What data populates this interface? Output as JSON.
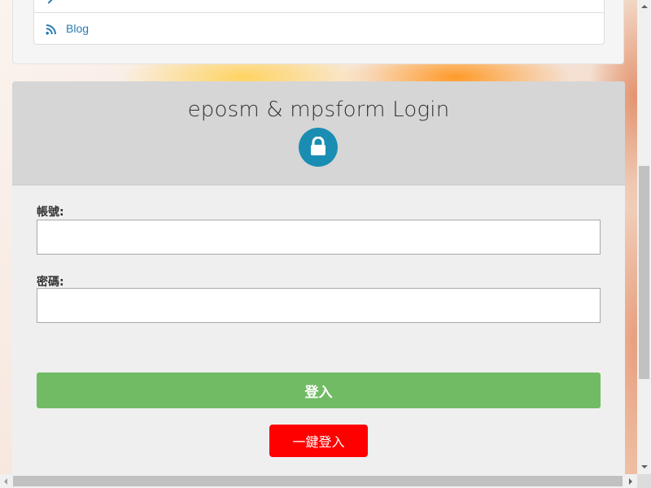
{
  "links": {
    "items": [
      {
        "label": "Blog",
        "icon": "rss-icon"
      }
    ]
  },
  "login": {
    "title": "eposm & mpsform Login",
    "icon": "lock-icon",
    "username_label": "帳號:",
    "username_value": "",
    "password_label": "密碼:",
    "password_value": "",
    "login_button": "登入",
    "quick_login_button": "一鍵登入"
  },
  "colors": {
    "link": "#2a7bb4",
    "lock_badge": "#1a8db3",
    "login_button": "#71bb64",
    "quick_login_button": "#ff0000",
    "header_bg": "#d6d6d6",
    "panel_bg": "#efefef"
  }
}
